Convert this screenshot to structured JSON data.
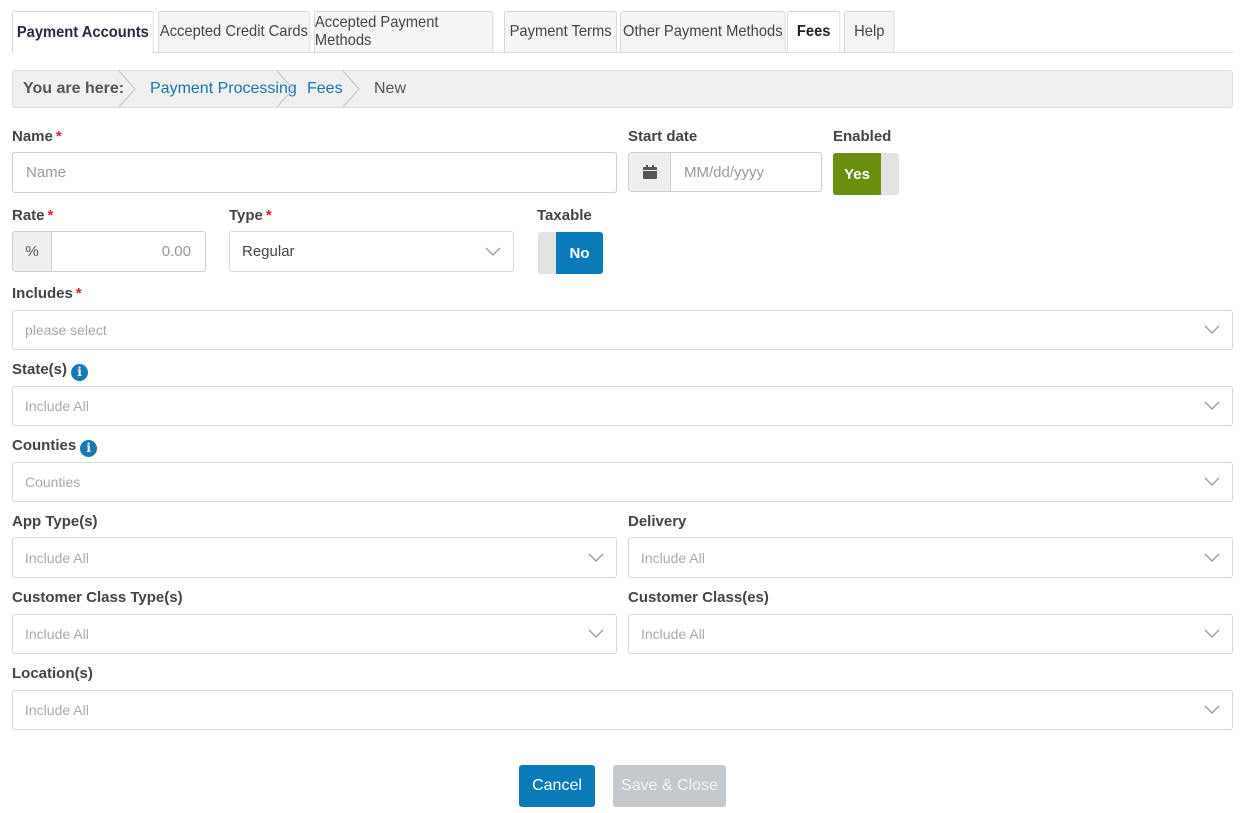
{
  "tabs": [
    {
      "label": "Payment Accounts"
    },
    {
      "label": "Accepted Credit Cards"
    },
    {
      "label": "Accepted Payment Methods"
    },
    {
      "label": "Payment Terms"
    },
    {
      "label": "Other Payment Methods"
    },
    {
      "label": "Fees"
    },
    {
      "label": "Help"
    }
  ],
  "breadcrumb": {
    "prefix": "You are here:",
    "items": [
      "Payment Processing",
      "Fees",
      "New"
    ]
  },
  "form": {
    "name": {
      "label": "Name",
      "required": "*",
      "placeholder": "Name"
    },
    "start_date": {
      "label": "Start date",
      "placeholder": "MM/dd/yyyy",
      "icon": "calendar-icon"
    },
    "enabled": {
      "label": "Enabled",
      "value": "Yes"
    },
    "rate": {
      "label": "Rate",
      "required": "*",
      "unit": "%",
      "placeholder": "0.00"
    },
    "type": {
      "label": "Type",
      "required": "*",
      "value": "Regular"
    },
    "taxable": {
      "label": "Taxable",
      "value": "No"
    },
    "includes": {
      "label": "Includes",
      "required": "*",
      "placeholder": "please select"
    },
    "states": {
      "label": "State(s)",
      "info": "i",
      "value": "Include All"
    },
    "counties": {
      "label": "Counties",
      "info": "i",
      "value": "Counties"
    },
    "app_types": {
      "label": "App Type(s)",
      "value": "Include All"
    },
    "delivery": {
      "label": "Delivery",
      "value": "Include All"
    },
    "customer_class_types": {
      "label": "Customer Class Type(s)",
      "value": "Include All"
    },
    "customer_classes": {
      "label": "Customer Class(es)",
      "value": "Include All"
    },
    "locations": {
      "label": "Location(s)",
      "value": "Include All"
    }
  },
  "actions": {
    "cancel": "Cancel",
    "save_close": "Save & Close"
  },
  "colors": {
    "primary": "#0a7bb8",
    "enabled_on": "#6a8f0f",
    "disabled_button": "#c4c9cd",
    "link": "#1b75a8",
    "required": "#d9232e"
  }
}
